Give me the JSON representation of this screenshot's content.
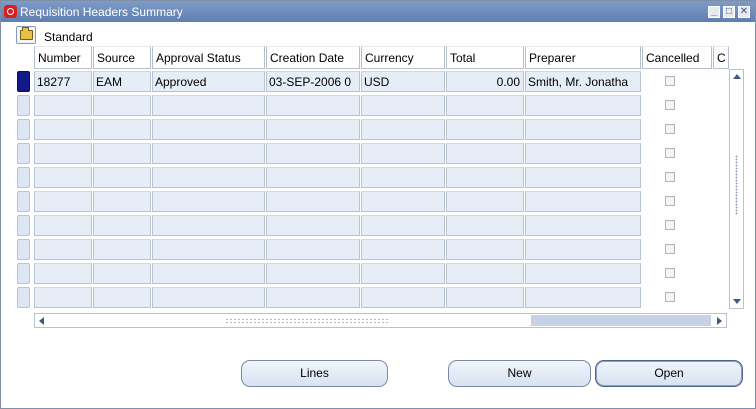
{
  "window": {
    "title": "Requisition Headers Summary",
    "icons": [
      "oracle-logo",
      "minimize-icon",
      "maximize-icon",
      "close-icon"
    ]
  },
  "folder": {
    "label": "Standard",
    "icon": "open-folder-icon"
  },
  "columns": [
    "Number",
    "Source",
    "Approval Status",
    "Creation Date",
    "Currency",
    "Total",
    "Preparer",
    "Cancelled",
    "C"
  ],
  "rows": [
    {
      "number": "18277",
      "source": "EAM",
      "approval_status": "Approved",
      "creation_date": "03-SEP-2006 0",
      "currency": "USD",
      "total": "0.00",
      "preparer": "Smith, Mr. Jonatha",
      "cancelled": false
    }
  ],
  "empty_row_count": 9,
  "buttons": {
    "lines": "Lines",
    "new": "New",
    "open": "Open"
  },
  "colors": {
    "titlebar": "#6b8ab8",
    "cell": "#e6edf6",
    "selected_record": "#12198a"
  }
}
